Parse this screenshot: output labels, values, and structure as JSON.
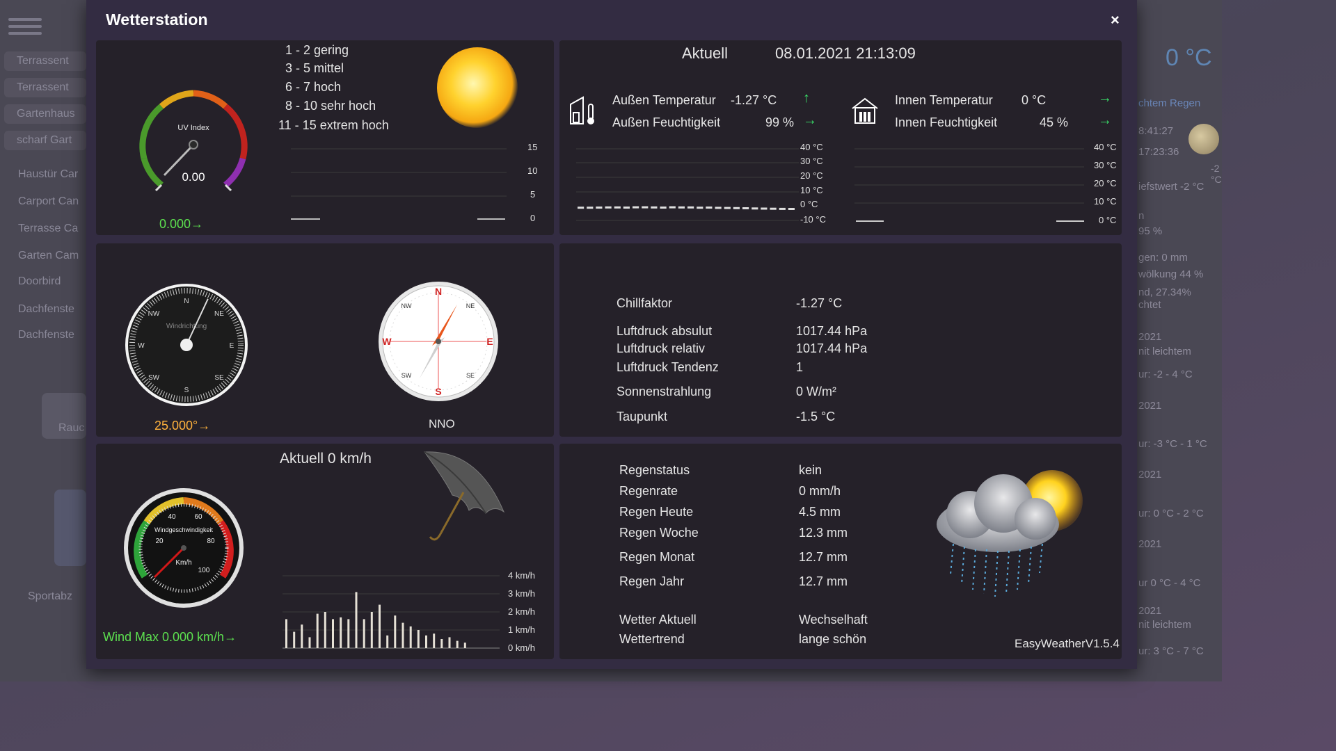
{
  "background": {
    "sidebar_items": [
      "Terrassent",
      "Terrassent",
      "Gartenhaus",
      "scharf Gart",
      "Haustür Car",
      "Carport Can",
      "Terrasse Ca",
      "Garten Cam",
      "Doorbird",
      "Dachfenste",
      "Dachfenste"
    ],
    "ghost_labels": [
      "Rauc",
      "Sportabz"
    ],
    "right_big_temp": "0 °C",
    "right_items": [
      "chtem Regen",
      "8:41:27",
      "17:23:36",
      "-2 °C",
      "iefstwert -2 °C",
      "n",
      "95 %",
      "gen:   0 mm",
      "wölkung  44 %",
      "nd, 27.34%",
      "chtet",
      "2021",
      "nit leichtem",
      "ur: -2 - 4 °C",
      "2021",
      "ur: -3 °C - 1 °C",
      "2021",
      "ur: 0 °C - 2 °C",
      "2021",
      "ur 0 °C - 4 °C",
      "2021",
      "nit leichtem",
      "ur: 3 °C - 7 °C"
    ]
  },
  "modal": {
    "title": "Wetterstation",
    "close": "×"
  },
  "uv": {
    "gauge_title": "UV Index",
    "value": "0.00",
    "value_readout": "0.000→",
    "legend": [
      "1  -  2 gering",
      "3  -  5 mittel",
      "6  -  7 hoch",
      "8  - 10 sehr hoch",
      "11  - 15 extrem hoch"
    ],
    "chart_axis": [
      "15",
      "10",
      "5",
      "0"
    ]
  },
  "current": {
    "label": "Aktuell",
    "datetime": "08.01.2021 21:13:09",
    "outside_temp_label": "Außen Temperatur",
    "outside_temp": "-1.27 °C",
    "outside_temp_trend": "↑",
    "outside_hum_label": "Außen Feuchtigkeit",
    "outside_hum": "99 %",
    "outside_hum_trend": "→",
    "inside_temp_label": "Innen Temperatur",
    "inside_temp": "0 °C",
    "inside_temp_trend": "→",
    "inside_hum_label": "Innen Feuchtigkeit",
    "inside_hum": "45 %",
    "inside_hum_trend": "→",
    "outside_axis": [
      "40 °C",
      "30 °C",
      "20 °C",
      "10 °C",
      "0 °C",
      "-10 °C"
    ],
    "inside_axis": [
      "40 °C",
      "30 °C",
      "20 °C",
      "10 °C",
      "0 °C"
    ]
  },
  "wind_dir": {
    "dial_label": "Windrichtung",
    "points": [
      "N",
      "NE",
      "E",
      "SE",
      "S",
      "SW",
      "W",
      "NW"
    ],
    "degrees_readout": "25.000°→",
    "compass_label": "NNO",
    "degrees": 25
  },
  "details": {
    "rows": [
      {
        "label": "Chillfaktor",
        "value": "-1.27 °C"
      },
      {
        "label": "Luftdruck absulut",
        "value": "1017.44 hPa"
      },
      {
        "label": "Luftdruck relativ",
        "value": "1017.44 hPa"
      },
      {
        "label": "Luftdruck Tendenz",
        "value": "1"
      },
      {
        "label": "Sonnenstrahlung",
        "value": "0 W/m²"
      },
      {
        "label": "Taupunkt",
        "value": "-1.5 °C"
      }
    ]
  },
  "wind_speed": {
    "current": "Aktuell 0 km/h",
    "gauge_title": "Windgeschwindigkeit",
    "gauge_unit": "Km/h",
    "gauge_ticks": [
      "20",
      "40",
      "60",
      "80",
      "100"
    ],
    "max_readout": "Wind Max 0.000 km/h→",
    "chart_axis": [
      "4 km/h",
      "3 km/h",
      "2 km/h",
      "1 km/h",
      "0 km/h"
    ]
  },
  "rain": {
    "rows": [
      {
        "label": "Regenstatus",
        "value": "kein"
      },
      {
        "label": "Regenrate",
        "value": "0 mm/h"
      },
      {
        "label": "Regen Heute",
        "value": "4.5 mm"
      },
      {
        "label": "Regen Woche",
        "value": "12.3 mm"
      },
      {
        "label": "Regen Monat",
        "value": "12.7 mm"
      },
      {
        "label": "Regen Jahr",
        "value": "12.7 mm"
      }
    ],
    "weather_now_label": "Wetter Aktuell",
    "weather_now": "Wechselhaft",
    "trend_label": "Wettertrend",
    "trend": "lange schön",
    "version": "EasyWeatherV1.5.4"
  },
  "chart_data": [
    {
      "type": "bar",
      "title": "",
      "ylabel": "",
      "ylim": [
        0,
        4
      ],
      "y_ticks": [
        "4 km/h",
        "3 km/h",
        "2 km/h",
        "1 km/h",
        "0 km/h"
      ],
      "values": [
        1.6,
        0.9,
        1.3,
        0.6,
        1.9,
        2.0,
        1.6,
        1.7,
        1.6,
        3.1,
        1.6,
        2.0,
        2.4,
        0.7,
        1.8,
        1.4,
        1.2,
        1.0,
        0.7,
        0.8,
        0.5,
        0.6,
        0.4,
        0.3
      ]
    },
    {
      "type": "line",
      "title": "",
      "ylim": [
        -10,
        40
      ],
      "y_ticks": [
        "40 °C",
        "30 °C",
        "20 °C",
        "10 °C",
        "0 °C",
        "-10 °C"
      ],
      "values": [
        -0.4,
        -0.4,
        -0.3,
        -0.2,
        -0.2,
        -0.3,
        -0.1,
        -0.1,
        -0.2,
        -0.3,
        -0.1,
        -0.2,
        -0.2,
        -0.4,
        -0.3,
        -0.5,
        -0.6,
        -0.7,
        -0.8,
        -0.9,
        -1.0,
        -1.1,
        -1.2,
        -1.27
      ]
    }
  ]
}
